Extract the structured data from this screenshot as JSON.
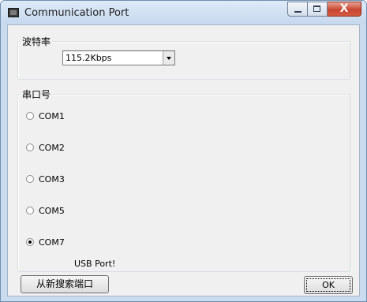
{
  "window": {
    "title": "Communication Port",
    "close_glyph": "X"
  },
  "baud_group": {
    "label": "波特率",
    "selected_value": "115.2Kbps"
  },
  "port_group": {
    "label": "串口号",
    "options": [
      {
        "label": "COM1",
        "checked": false
      },
      {
        "label": "COM2",
        "checked": false
      },
      {
        "label": "COM3",
        "checked": false
      },
      {
        "label": "COM5",
        "checked": false
      },
      {
        "label": "COM7",
        "checked": true
      }
    ],
    "selected_note": "USB Port!"
  },
  "buttons": {
    "rescan_label": "从新搜索端口",
    "ok_label": "OK"
  },
  "icons": [
    "app-icon",
    "minimize-icon",
    "maximize-icon",
    "close-icon",
    "dropdown-arrow-icon",
    "radio-icon"
  ]
}
